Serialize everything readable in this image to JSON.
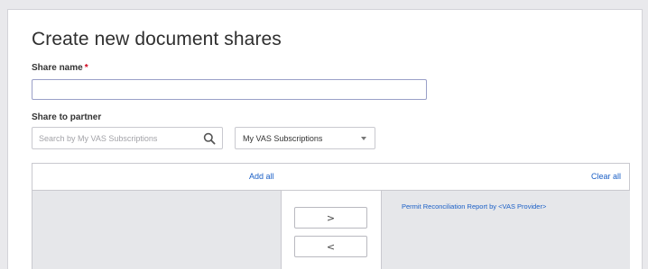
{
  "page": {
    "title": "Create new document shares"
  },
  "form": {
    "share_name": {
      "label": "Share name",
      "required_marker": "*",
      "value": ""
    },
    "share_to_partner": {
      "label": "Share to partner",
      "search_placeholder": "Search by My VAS Subscriptions",
      "search_icon": "search-icon",
      "filter_selected": "My VAS Subscriptions"
    }
  },
  "shuttle": {
    "add_all_label": "Add all",
    "clear_all_label": "Clear all",
    "move_right_label": ">",
    "move_left_label": "<",
    "available_items": [],
    "selected_items": [
      "Permit Reconciliation Report by <VAS Provider>"
    ]
  },
  "colors": {
    "link": "#1a5fc6",
    "required": "#d0021b",
    "list_bg": "#e6e7ea"
  }
}
